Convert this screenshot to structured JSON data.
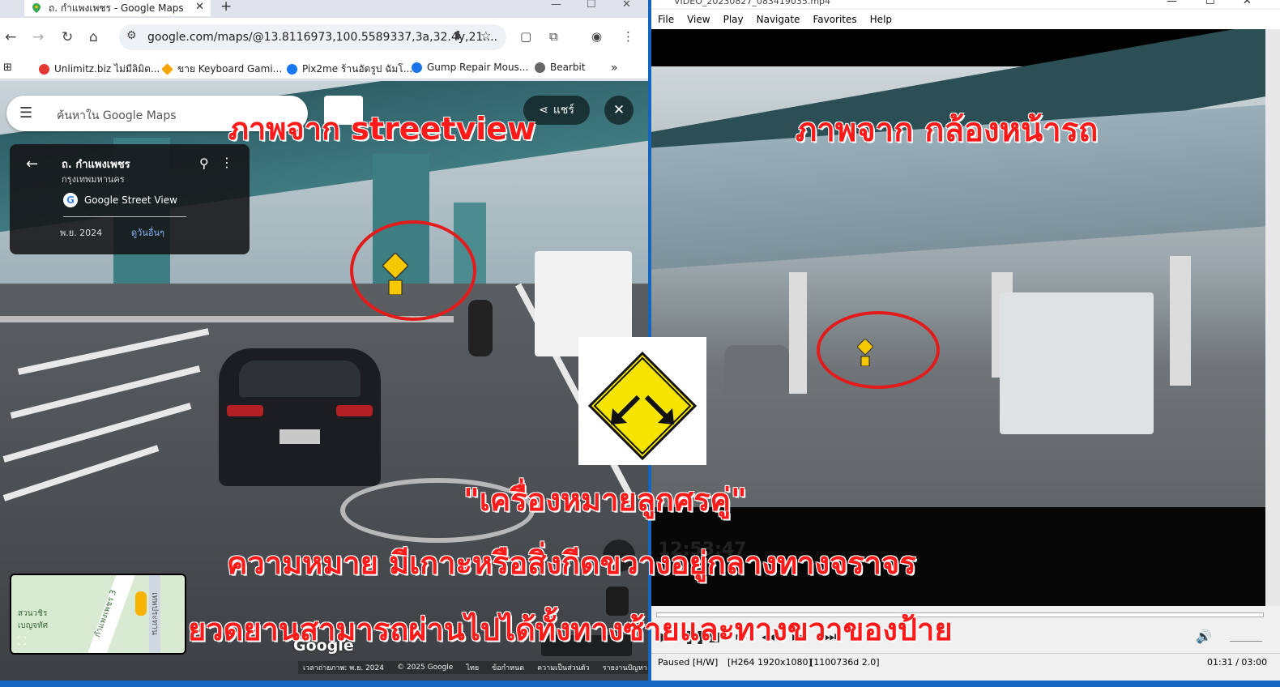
{
  "chrome": {
    "tab_title": "ถ. กำแพงเพชร - Google Maps",
    "new_tab": "+",
    "url": "google.com/maps/@13.8116973,100.5589337,3a,32.4y,21....",
    "bookmarks": [
      "Unlimitz.biz ไม่มีลิมิต...",
      "ขาย Keyboard Gami...",
      "Pix2me ร้านอัดรูป ฉัมโ...",
      "Gump Repair Mous...",
      "Bearbit"
    ],
    "bookmarks_more": "»"
  },
  "maps": {
    "search_placeholder": "ค้นหาใน Google Maps",
    "share_label": "แชร์",
    "card": {
      "title": "ถ. กำแพงเพชร",
      "subtitle": "กรุงเทพมหานคร",
      "source": "Google Street View",
      "date": "พ.ย. 2024",
      "other_dates": "ดูวันอื่นๆ"
    },
    "minimap_labels": [
      "สวนวชิร เบญจทัศ",
      "กำแพงเพชร 3",
      "เทพประทาน"
    ],
    "google_logo": "Google",
    "footer": [
      "เวลาถ่ายภาพ: พ.ย. 2024",
      "© 2025 Google",
      "ไทย",
      "ข้อกำหนด",
      "ความเป็นส่วนตัว",
      "รายงานปัญหา"
    ]
  },
  "player": {
    "title": "VIDEO_20230827_083419035.mp4",
    "menu": [
      "File",
      "View",
      "Play",
      "Navigate",
      "Favorites",
      "Help"
    ],
    "overlay_time": "12:53:47",
    "status_state": "Paused [H/W]",
    "status_codec": "[H264 1920x1080]",
    "status_info": "[1100736d 2.0]",
    "status_time": "01:31 / 03:00"
  },
  "annotations": {
    "left_caption": "ภาพจาก streetview",
    "right_caption": "ภาพจาก กล้องหน้ารถ",
    "sign_name": "\"เครื่องหมายลูกศรคู่\"",
    "meaning": "ความหมาย มีเกาะหรือสิ่งกีดขวางอยู่กลางทางจราจร",
    "instruction": "ยวดยานสามารถผ่านไปได้ทั้งทางซ้ายและทางขวาของป้าย"
  },
  "colors": {
    "annotation_red": "#ff1a1a",
    "sign_yellow": "#f5e400",
    "desktop_blue": "#1565c0"
  }
}
